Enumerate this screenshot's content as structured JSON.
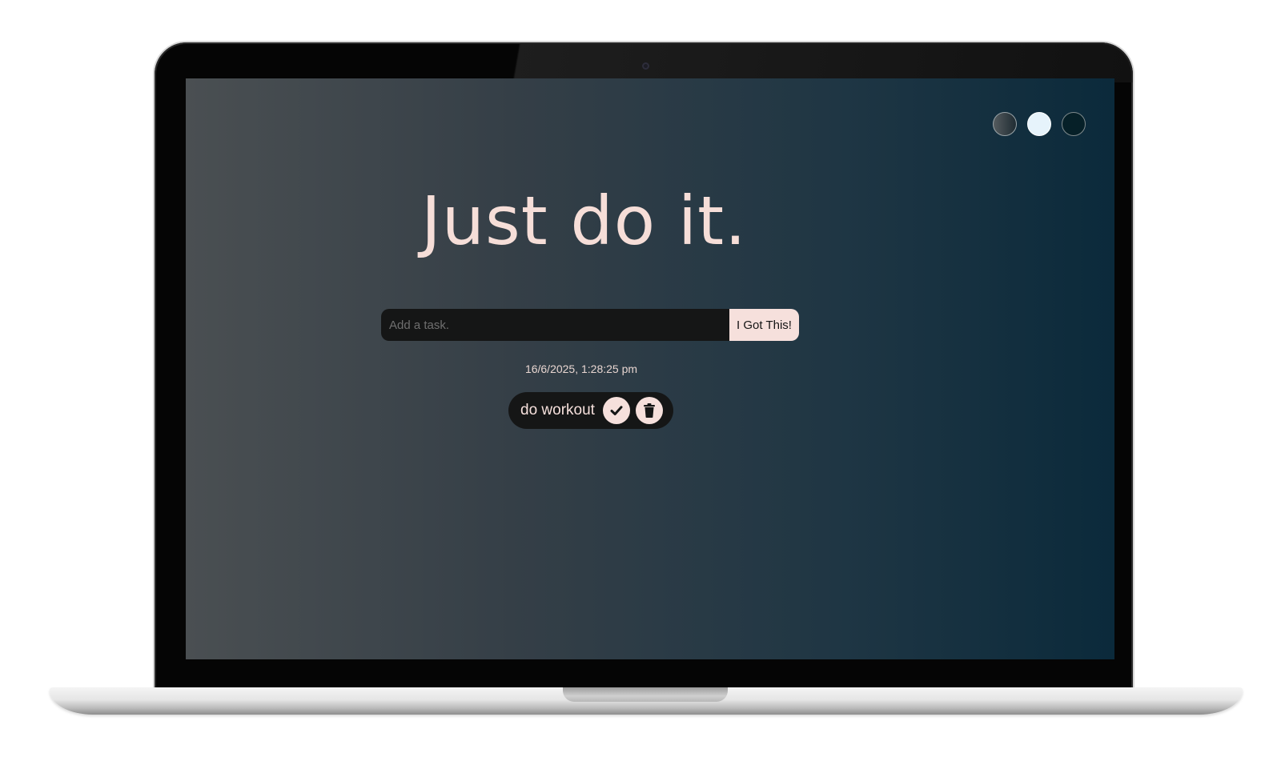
{
  "app": {
    "headline": "Just do it.",
    "theme_switcher": {
      "themes": [
        "standard",
        "light",
        "darker"
      ],
      "selected": "light"
    },
    "task_form": {
      "input_value": "",
      "input_placeholder": "Add a task.",
      "submit_label": "I Got This!"
    },
    "datetime": "16/6/2025, 1:28:25 pm",
    "todos": [
      {
        "text": "do workout",
        "icons": [
          "check-icon",
          "trash-icon"
        ]
      }
    ]
  },
  "colors": {
    "accent": "#f6e0dc",
    "input_bg": "#151616",
    "gradient_start": "#4a4f52",
    "gradient_end": "#0b2a3b",
    "bezel": "#050505"
  }
}
